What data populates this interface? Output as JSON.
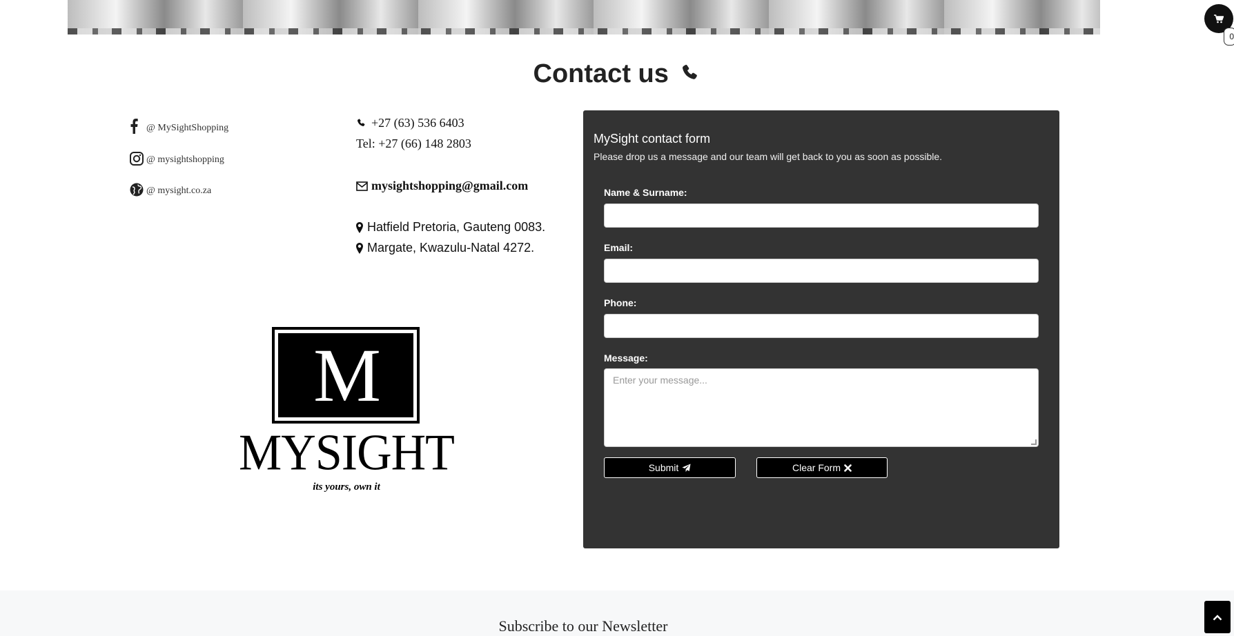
{
  "header": {
    "cart_count": "0"
  },
  "contact": {
    "heading": "Contact us"
  },
  "socials": [
    {
      "icon": "facebook-icon",
      "label": "@ MySightShopping"
    },
    {
      "icon": "instagram-icon",
      "label": "@ mysightshopping"
    },
    {
      "icon": "globe-icon",
      "label": "@ mysight.co.za"
    }
  ],
  "info": {
    "phone": "+27 (63) 536 6403",
    "tel": "Tel: +27 (66) 148 2803",
    "email": "mysightshopping@gmail.com",
    "address1": "Hatfield Pretoria, Gauteng 0083.",
    "address2": "Margate, Kwazulu-Natal 4272."
  },
  "logo": {
    "letter": "M",
    "wordmark": "MYSIGHT",
    "tagline": "its yours, own it"
  },
  "form": {
    "title": "MySight contact form",
    "subtitle": "Please drop us a message and our team will get back to you as soon as possible.",
    "name_label": "Name & Surname:",
    "email_label": "Email:",
    "phone_label": "Phone:",
    "message_label": "Message:",
    "message_placeholder": "Enter your message...",
    "submit_label": "Submit",
    "clear_label": "Clear Form"
  },
  "newsletter": {
    "title": "Subscribe to our Newsletter"
  },
  "colors": {
    "form_bg": "#333333",
    "button_bg": "#000000",
    "newsletter_bg": "#f7f8f9"
  }
}
